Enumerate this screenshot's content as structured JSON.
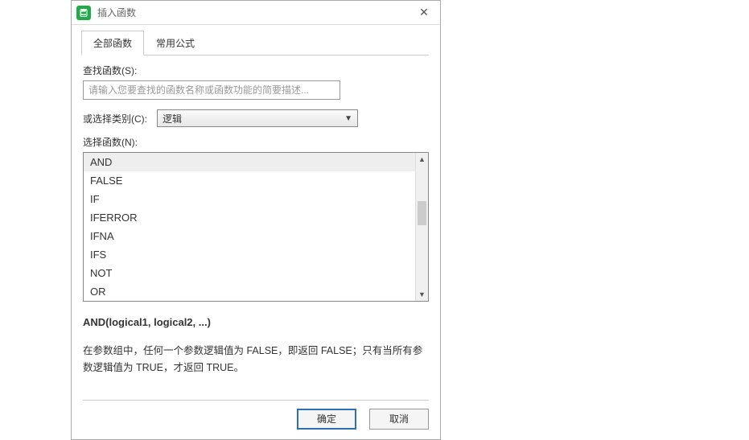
{
  "titlebar": {
    "title": "插入函数"
  },
  "tabs": {
    "all": "全部函数",
    "common": "常用公式"
  },
  "search": {
    "label": "查找函数(S):",
    "placeholder": "请输入您要查找的函数名称或函数功能的简要描述..."
  },
  "category": {
    "label": "或选择类别(C):",
    "selected": "逻辑"
  },
  "functionList": {
    "label": "选择函数(N):",
    "items": [
      "AND",
      "FALSE",
      "IF",
      "IFERROR",
      "IFNA",
      "IFS",
      "NOT",
      "OR"
    ],
    "selectedIndex": 0
  },
  "detail": {
    "signature": "AND(logical1, logical2, ...)",
    "description": "在参数组中，任何一个参数逻辑值为 FALSE，即返回 FALSE；只有当所有参数逻辑值为 TRUE，才返回 TRUE。"
  },
  "buttons": {
    "ok": "确定",
    "cancel": "取消"
  }
}
